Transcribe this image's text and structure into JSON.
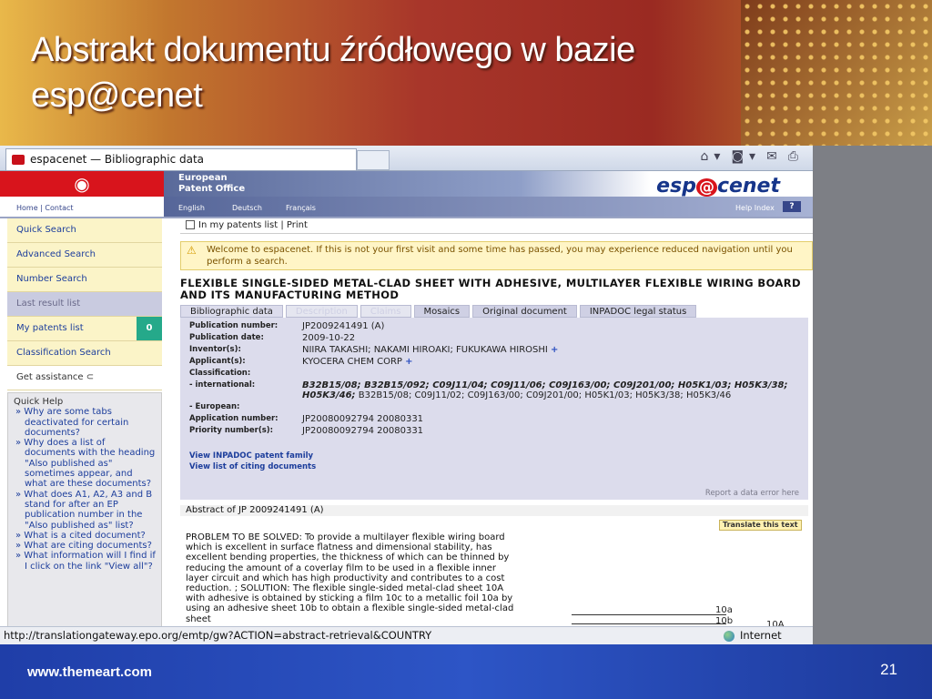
{
  "slide": {
    "title": "Abstrakt dokumentu źródłowego w bazie esp@cenet",
    "footer_url": "www.themeart.com",
    "page_number": "21"
  },
  "browser": {
    "tab_title": "espacenet — Bibliographic data",
    "status_url": "http://translationgateway.epo.org/emtp/gw?ACTION=abstract-retrieval&COUNTRY",
    "status_zone": "Internet"
  },
  "header": {
    "office_line1": "European",
    "office_line2": "Patent Office",
    "logo_left": "esp",
    "logo_at": "@",
    "logo_right": "cenet",
    "home_contact": "Home | Contact",
    "languages": [
      "English",
      "Deutsch",
      "Français"
    ],
    "help_index": "Help Index",
    "help_q": "?"
  },
  "sidebar": {
    "items": [
      {
        "label": "Quick Search"
      },
      {
        "label": "Advanced Search"
      },
      {
        "label": "Number Search"
      },
      {
        "label": "Last result list"
      },
      {
        "label": "My patents list",
        "badge": "0"
      },
      {
        "label": "Classification Search"
      },
      {
        "label": "Get assistance ⊂"
      }
    ],
    "quick_help_title": "Quick Help",
    "quick_help_items": [
      "» Why are some tabs deactivated for certain documents?",
      "» Why does a list of documents with the heading \"Also published as\" sometimes appear, and what are these documents?",
      "» What does A1, A2, A3 and B stand for after an EP publication number in the \"Also published as\" list?",
      "» What is a cited document?",
      "» What are citing documents?",
      "» What information will I find if I click on the link \"View all\"?"
    ]
  },
  "main": {
    "actions_label": "In my patents list  |  Print",
    "warning": "Welcome to espacenet. If this is not your first visit and some time has passed, you may experience reduced navigation until you perform a search.",
    "doc_title": "FLEXIBLE SINGLE-SIDED METAL-CLAD SHEET WITH ADHESIVE, MULTILAYER FLEXIBLE WIRING BOARD AND ITS MANUFACTURING METHOD",
    "tabs": [
      "Bibliographic data",
      "Description",
      "Claims",
      "Mosaics",
      "Original document",
      "INPADOC legal status"
    ],
    "biblio": {
      "pub_number_label": "Publication number:",
      "pub_number": "JP2009241491 (A)",
      "pub_date_label": "Publication date:",
      "pub_date": "2009-10-22",
      "inventors_label": "Inventor(s):",
      "inventors": "NIIRA TAKASHI; NAKAMI HIROAKI; FUKUKAWA HIROSHI",
      "applicants_label": "Applicant(s):",
      "applicants": "KYOCERA CHEM CORP",
      "classification_label": "Classification:",
      "international_label": "- international:",
      "international_bold": "B32B15/08; B32B15/092; C09J11/04; C09J11/06; C09J163/00; C09J201/00; H05K1/03; H05K3/38; H05K3/46;",
      "international_rest": " B32B15/08; C09J11/02; C09J163/00; C09J201/00; H05K1/03; H05K3/38; H05K3/46",
      "european_label": "- European:",
      "app_number_label": "Application number:",
      "app_number": "JP20080092794 20080331",
      "priority_label": "Priority number(s):",
      "priority": "JP20080092794 20080331",
      "link_inpadoc": "View INPADOC patent family",
      "link_citing": "View list of citing documents",
      "report_error": "Report a data error here",
      "plus": "+"
    },
    "abstract": {
      "heading": "Abstract of JP 2009241491  (A)",
      "translate": "Translate this text",
      "text": "PROBLEM TO BE SOLVED: To provide a multilayer flexible wiring board which is excellent in surface flatness and dimensional stability, has excellent bending properties, the thickness of which can be thinned by reducing the amount of a coverlay film to be used in a flexible inner layer circuit and which has high productivity and contributes to a cost reduction. ; SOLUTION: The flexible single-sided metal-clad sheet 10A with adhesive is obtained by sticking a film 10c to a metallic foil 10a by using an adhesive sheet 10b to obtain a flexible single-sided metal-clad sheet",
      "fig_labels": [
        "10a",
        "10b",
        "10A"
      ]
    }
  }
}
